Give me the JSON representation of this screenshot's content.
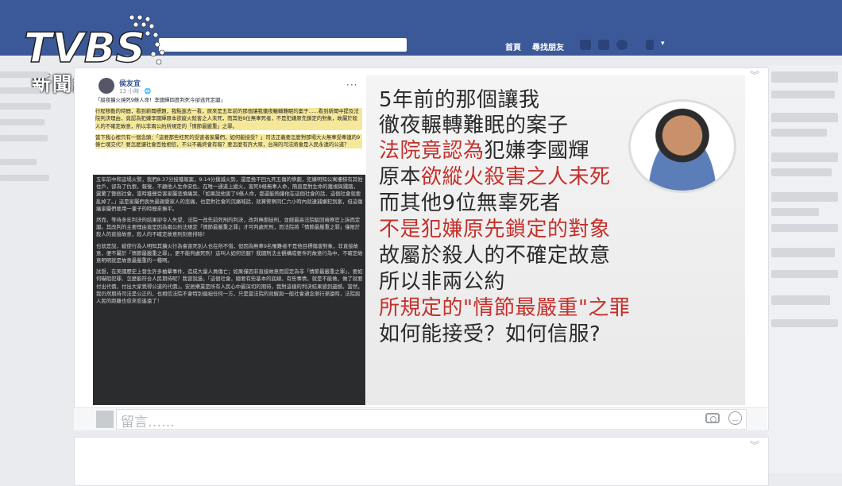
{
  "header": {
    "nav_home": "首頁",
    "nav_find_friends": "尋找朋友"
  },
  "logo": {
    "brand": "TVBS",
    "subtitle": "新聞網"
  },
  "post": {
    "author": "侯友宜",
    "time": "13 小時 · 🌐",
    "title": "「縱夜擴火燒死9條人命！李國輝四度判死今卻逃死定讞」",
    "para1": "行程移動的時間，看到新聞標題，我點進去一看，原來是五年前的那個讓我徹夜輾轉難眠的案子......看到新聞中提及法院判決理由，竟認為犯嫌李國輝原本欲縱火殺害之人未死，而其他9位無辜死者，不是犯嫌原先鎖定的對象，故屬於殺人的不確定故意，所以非兩公約所規定的「情節最嚴重」之罪。",
    "para2": "當下我心裡只有一個念頭：「這要那些枉死的受害者家屬們，如何能接受？」司法正義要怎麼對那場大火無辜受牽連的9條亡魂交代？要怎麼讓社會百姓相信，不公不義終會有報？要怎麼有許大眾，台灣的司法將會是人民永遠的公道？",
    "para3": "五年前中和這場火警，我們8:37分接獲報案，9:14分撲滅火勢，還是挽不回九死五傷的慘劇，犯嫌明知公寓樓梯有其他住戶，卻為了仇恨，報復，不顧他人生命安危，在唯一通道上縱火，害死9條無辜人命，簡直是對生命的蔑視與踐踏，震驚了整個社會。當時獲聲受害家屬悲憤痛哭，「如果說他害了9條人命，都還能夠讓他在這個社會的話，這個社會就要亂掉了。」這是家屬們喪失最親愛家人的悲痛，也是對社會的沉痛喊話，就算警察同仁六小時內就逮捕嫌犯到案，但這傷痛家屬們要用一輩子的時間來撫平。",
    "para4": "然而，等待多年判決的結果卻令人失望，法院一改先前死刑的判決，改判無期徒刑，並經最高法院駁回檢察官上訴而定讞。其改判的主要理由竟是因為兩公約法規定「情節最嚴重之罪」才可判處死刑，而法院將「情節最嚴重之罪」僅限於殺人的直接故意，殺人的不確定故意則刻意排除！",
    "para5": "也就是說，縱使行為人明知其擴火行為會害死別人也在所不惜，但因為無辜9名罹難者不是他目標傷害對象，非直接故意，便不屬於「情節最嚴重之罪」，更不能判處死刑！這叫人如何信服？我國刑法主觀構成要件的故意行為中，不確定故意明明就是故意最嚴重的一種啊。",
    "para6": "試想，在美國歷史上發生許多槍擊事件，造成大量人員傷亡；如果僅因非直接故意而認定為非「情節最嚴重之罪」，要如何嚇阻犯罪、怎麼能符合人民期待呢？我曾說過，「這個社會，總要有些基本的底線，有些事情，就是不能做，做了就要付出代價，付出大家覺得公道的代價」，安居樂業是所有人民心中最深切的期待，我對這樣的判決結果感到遺憾。當然，我仍然期待司法是公正的，也相信法院不會特別偏袒任何一方，只是當法院的見解與一般社會通念漸行漸遠時，法院與人民的距離也愈來愈遙遠了！"
  },
  "image_text": {
    "line1": "5年前的那個讓我",
    "line2": "徹夜輾轉難眠的案子",
    "line3_red": "法院竟認為",
    "line3_dark": "犯嫌李國輝",
    "line4_dark": "原本",
    "line4_red": "欲縱火殺害之人未死",
    "line5": "而其他9位無辜死者",
    "line6_red": "不是犯嫌原先鎖定的對象",
    "line7": "故屬於殺人的不確定故意",
    "line8": "所以非兩公約",
    "line9_red": "所規定的\"情節最嚴重\"之罪",
    "line10": "如何能接受？如何信服?"
  },
  "comment": {
    "placeholder": "留言……"
  },
  "colors": {
    "topbar": "#3b5998",
    "highlight_red": "#c4302b"
  }
}
